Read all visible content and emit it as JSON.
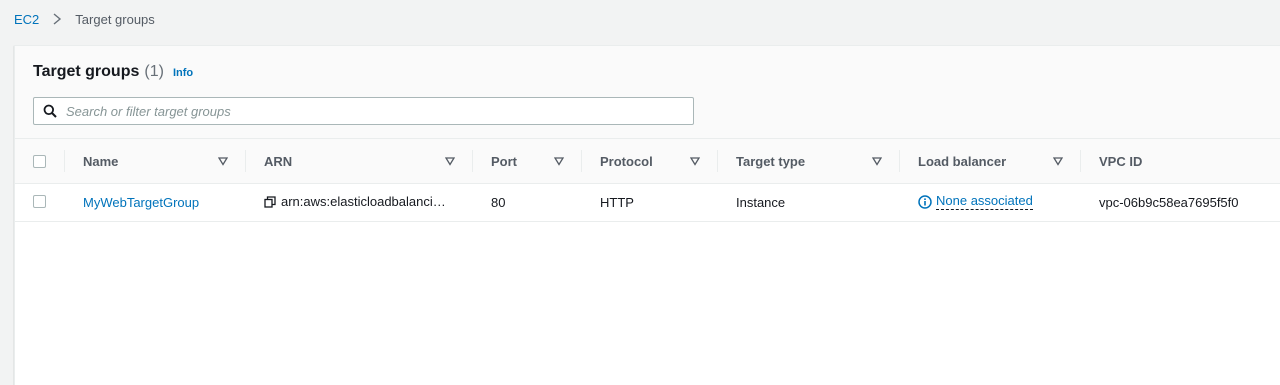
{
  "breadcrumb": {
    "root": "EC2",
    "current": "Target groups"
  },
  "header": {
    "title": "Target groups",
    "count": "(1)",
    "info": "Info"
  },
  "search": {
    "placeholder": "Search or filter target groups",
    "value": ""
  },
  "table": {
    "columns": [
      "Name",
      "ARN",
      "Port",
      "Protocol",
      "Target type",
      "Load balancer",
      "VPC ID"
    ],
    "rows": [
      {
        "name": "MyWebTargetGroup",
        "arn": "arn:aws:elasticloadbalancing:...",
        "port": "80",
        "protocol": "HTTP",
        "target_type": "Instance",
        "load_balancer": "None associated",
        "vpc_id": "vpc-06b9c58ea7695f5f0"
      }
    ]
  },
  "colors": {
    "link": "#0073bb",
    "background": "#f2f3f3",
    "header_bg": "#fafafa"
  }
}
